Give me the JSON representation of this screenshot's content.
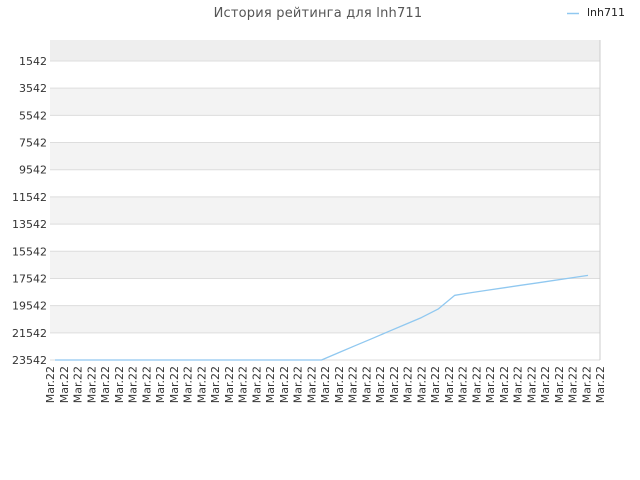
{
  "chart_data": {
    "type": "line",
    "title": "История рейтинга для lnh711",
    "xlabel": "",
    "ylabel": "",
    "y_inverted": true,
    "ylim": [
      23542,
      0
    ],
    "y_ticks": [
      1542,
      3542,
      5542,
      7542,
      9542,
      11542,
      13542,
      15542,
      17542,
      19542,
      21542,
      23542
    ],
    "grid": true,
    "legend_position": "top-right",
    "categories": [
      "Mar.22",
      "Mar.22",
      "Mar.22",
      "Mar.22",
      "Mar.22",
      "Mar.22",
      "Mar.22",
      "Mar.22",
      "Mar.22",
      "Mar.22",
      "Mar.22",
      "Mar.22",
      "Mar.22",
      "Mar.22",
      "Mar.22",
      "Mar.22",
      "Mar.22",
      "Mar.22",
      "Mar.22",
      "Mar.22",
      "Mar.22",
      "Mar.22",
      "Mar.22",
      "Mar.22",
      "Mar.22",
      "Mar.22",
      "Mar.22",
      "Mar.22",
      "Mar.22",
      "Mar.22",
      "Mar.22",
      "Mar.22",
      "Mar.22",
      "Mar.22",
      "Mar.22",
      "Mar.22",
      "Mar.22",
      "Mar.22",
      "Mar.22",
      "Mar.22",
      "Mar.22"
    ],
    "series": [
      {
        "name": "lnh711",
        "color": "#90c8f0",
        "values": [
          23542,
          23542,
          23542,
          23542,
          23542,
          23542,
          23542,
          23542,
          23542,
          23542,
          23542,
          23542,
          23542,
          23542,
          23542,
          23542,
          23542,
          23020,
          22500,
          21980,
          21460,
          20940,
          20420,
          19800,
          18780,
          18580,
          18400,
          18220,
          18040,
          17860,
          17680,
          17500,
          17320
        ]
      }
    ],
    "colors": {
      "band_dark": "#eeeeee",
      "band_light": "#f3f3f3",
      "band_white": "#ffffff",
      "grid": "#dddddd",
      "axis": "#cccccc"
    }
  }
}
